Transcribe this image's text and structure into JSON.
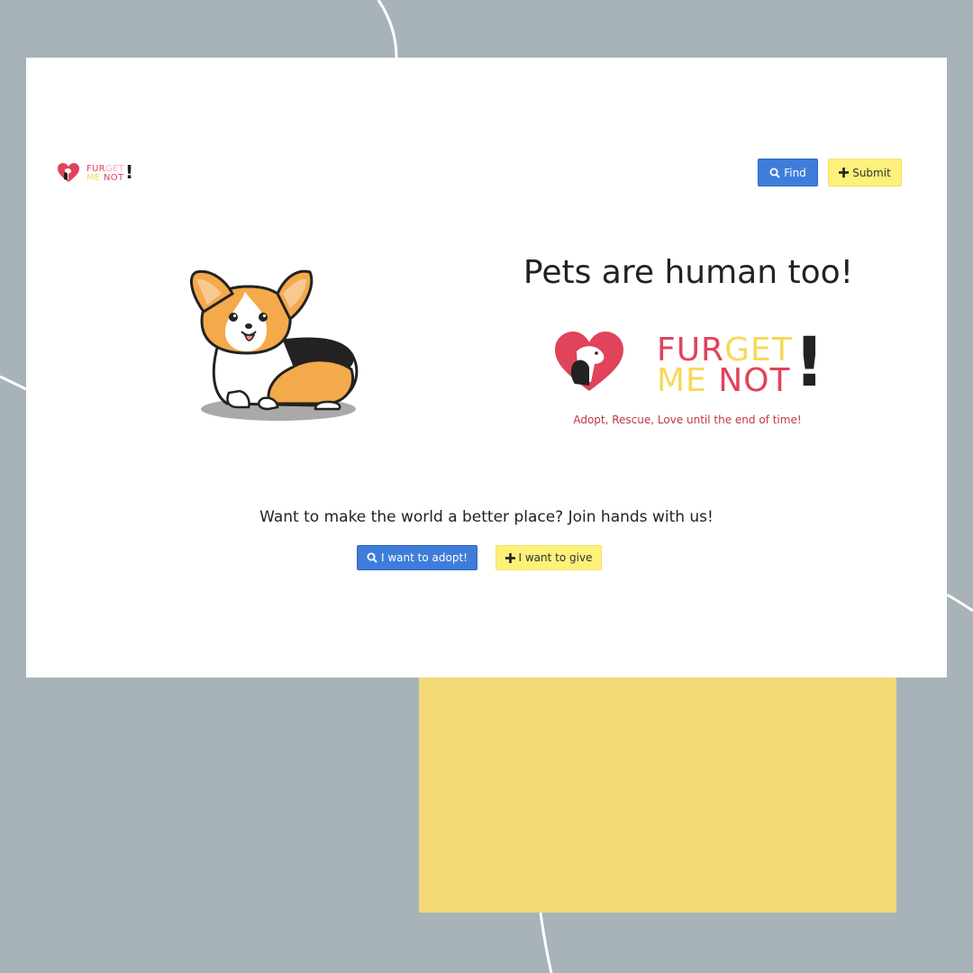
{
  "nav": {
    "logo": {
      "line1a": "FUR",
      "line1b": "GET",
      "line2a": "ME",
      "line2b": " NOT",
      "bang": "!"
    },
    "find_label": "Find",
    "find_icon": "search-icon",
    "submit_label": "Submit",
    "submit_icon": "plus-icon"
  },
  "hero": {
    "headline": "Pets are human too!",
    "logo": {
      "line1a": "FUR",
      "line1b": "GET",
      "line2a": "ME",
      "line2b": " NOT",
      "bang": "!"
    },
    "tagline": "Adopt, Rescue, Love until the end of time!"
  },
  "cta": {
    "text": "Want to make the world a better place? Join hands with us!",
    "adopt_label": "I want to adopt!",
    "adopt_icon": "search-icon",
    "give_label": "I want to give",
    "give_icon": "plus-icon"
  },
  "colors": {
    "background": "#a7b3b9",
    "accent_yellow_block": "#f2d976",
    "primary_blue": "#3f7ddb",
    "button_yellow": "#fdf17a",
    "brand_red": "#e0435a",
    "brand_yellow": "#f6d95a",
    "tagline": "#c0354b"
  }
}
